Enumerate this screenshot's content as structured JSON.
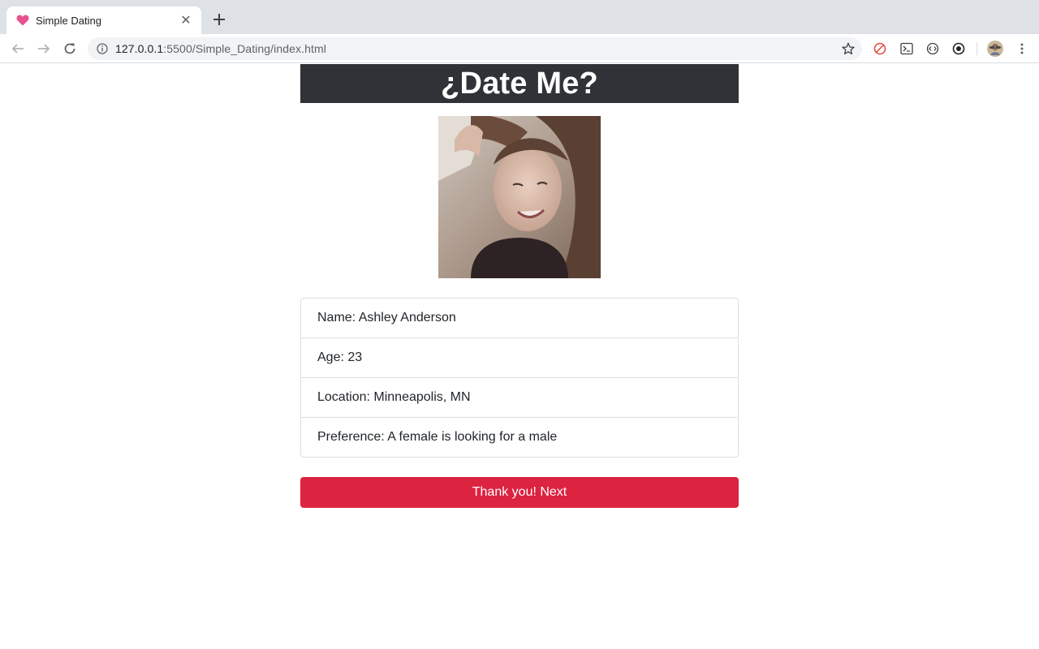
{
  "browser": {
    "tab_title": "Simple Dating",
    "url_host": "127.0.0.1",
    "url_rest": ":5500/Simple_Dating/index.html",
    "favicon_color": "#e8518c"
  },
  "page": {
    "title": "¿Date Me?",
    "header_bg": "#2f3337",
    "profile": {
      "name": "Name: Ashley Anderson",
      "age": "Age: 23",
      "location": "Location: Minneapolis, MN",
      "preference": "Preference: A female is looking for a male"
    },
    "next_button": "Thank you! Next",
    "button_color": "#dc2340"
  }
}
